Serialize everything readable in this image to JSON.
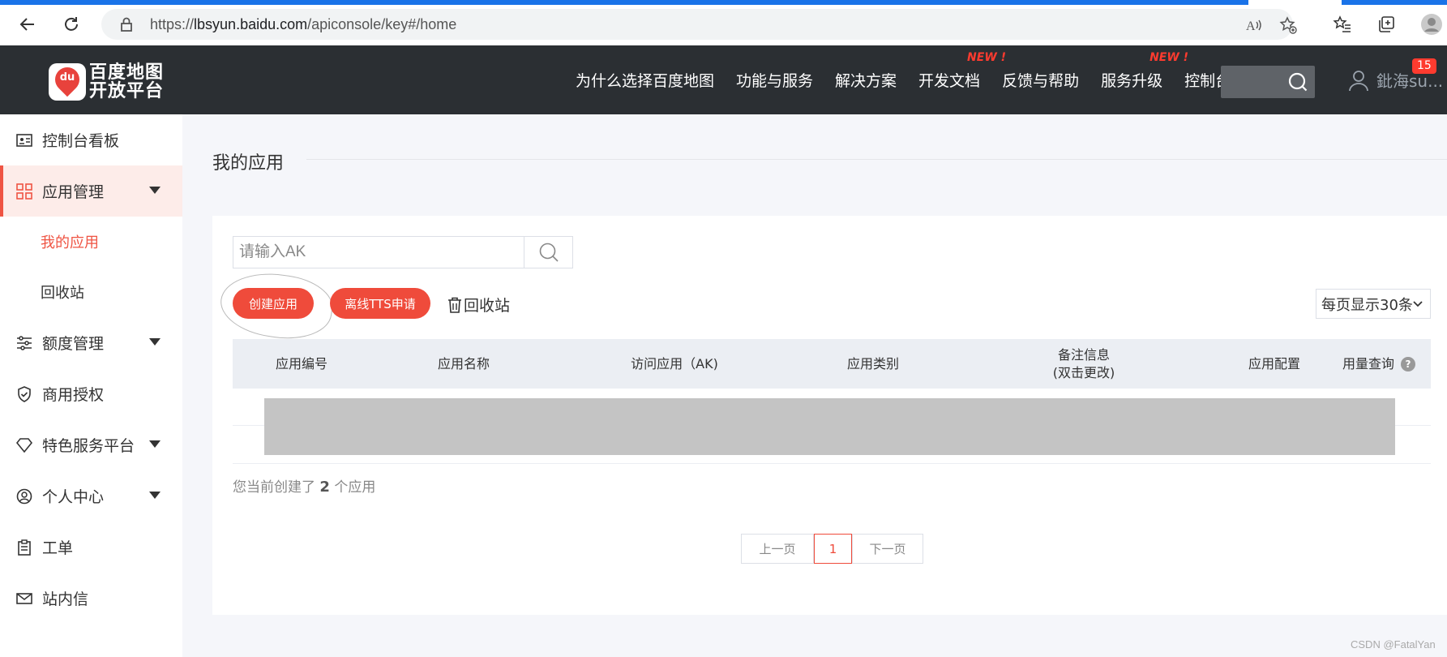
{
  "browser": {
    "url_prefix": "https://",
    "url_host": "lbsyun.baidu.com",
    "url_path": "/apiconsole/key#/home"
  },
  "header": {
    "logo_line1": "百度地图",
    "logo_line2": "开放平台",
    "logo_du": "du",
    "nav": [
      {
        "label": "为什么选择百度地图",
        "badge": ""
      },
      {
        "label": "功能与服务",
        "badge": ""
      },
      {
        "label": "解决方案",
        "badge": ""
      },
      {
        "label": "开发文档",
        "badge": "NEW !"
      },
      {
        "label": "反馈与帮助",
        "badge": ""
      },
      {
        "label": "服务升级",
        "badge": "NEW !"
      },
      {
        "label": "控制台",
        "badge": ""
      }
    ],
    "user_name": "鈚海su...",
    "notification_count": "15"
  },
  "sidebar": {
    "items": [
      {
        "label": "控制台看板"
      },
      {
        "label": "应用管理"
      },
      {
        "label": "我的应用"
      },
      {
        "label": "回收站"
      },
      {
        "label": "额度管理"
      },
      {
        "label": "商用授权"
      },
      {
        "label": "特色服务平台"
      },
      {
        "label": "个人中心"
      },
      {
        "label": "工单"
      },
      {
        "label": "站内信"
      }
    ]
  },
  "main": {
    "title": "我的应用",
    "search_placeholder": "请输入AK",
    "create_button": "创建应用",
    "tts_button": "离线TTS申请",
    "recycle_link": "回收站",
    "page_size": "每页显示30条",
    "columns": [
      {
        "label": "应用编号"
      },
      {
        "label": "应用名称"
      },
      {
        "label": "访问应用（AK)"
      },
      {
        "label": "应用类别"
      },
      {
        "label": "备注信息",
        "sub": "(双击更改)"
      },
      {
        "label": "应用配置"
      },
      {
        "label": "用量查询"
      }
    ],
    "count_prefix": "您当前创建了",
    "count_value": "2",
    "count_suffix": "个应用",
    "pager": {
      "prev": "上一页",
      "current": "1",
      "next": "下一页"
    }
  },
  "watermark": "CSDN @FatalYan",
  "colors": {
    "accent": "#ef4b3b",
    "header_bg": "#2b2f33",
    "browser_progress": "#1a73e8"
  }
}
